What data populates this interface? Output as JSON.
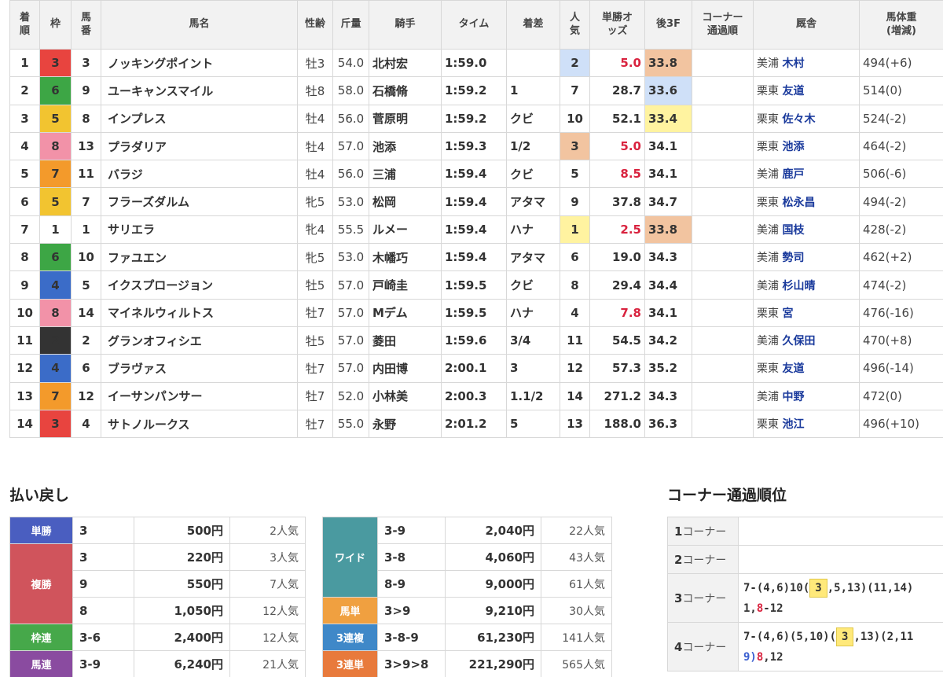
{
  "result_table": {
    "headers": {
      "rank": "着順",
      "waku": "枠",
      "umaban": "馬番",
      "name": "馬名",
      "sex_age": "性齢",
      "weight": "斤量",
      "jockey": "騎手",
      "time": "タイム",
      "margin": "着差",
      "pop": "人気",
      "odds": "単勝オッズ",
      "last3f": "後3F",
      "corner": "コーナー通過順",
      "stable": "厩舎",
      "body_weight": "馬体重(増減)"
    },
    "rows": [
      {
        "rank": "1",
        "waku": "3",
        "umaban": "3",
        "name": "ノッキングポイント",
        "sex_age": "牡3",
        "weight": "54.0",
        "jockey": "北村宏",
        "time": "1:59.0",
        "margin": "",
        "pop": "2",
        "odds": "5.0",
        "last3f": "33.8",
        "corner": "",
        "region": "美浦",
        "trainer": "木村",
        "body_weight": "494(+6)"
      },
      {
        "rank": "2",
        "waku": "6",
        "umaban": "9",
        "name": "ユーキャンスマイル",
        "sex_age": "牡8",
        "weight": "58.0",
        "jockey": "石橋脩",
        "time": "1:59.2",
        "margin": "1",
        "pop": "7",
        "odds": "28.7",
        "last3f": "33.6",
        "corner": "",
        "region": "栗東",
        "trainer": "友道",
        "body_weight": "514(0)"
      },
      {
        "rank": "3",
        "waku": "5",
        "umaban": "8",
        "name": "インプレス",
        "sex_age": "牡4",
        "weight": "56.0",
        "jockey": "菅原明",
        "time": "1:59.2",
        "margin": "クビ",
        "pop": "10",
        "odds": "52.1",
        "last3f": "33.4",
        "corner": "",
        "region": "栗東",
        "trainer": "佐々木",
        "body_weight": "524(-2)"
      },
      {
        "rank": "4",
        "waku": "8",
        "umaban": "13",
        "name": "プラダリア",
        "sex_age": "牡4",
        "weight": "57.0",
        "jockey": "池添",
        "time": "1:59.3",
        "margin": "1/2",
        "pop": "3",
        "odds": "5.0",
        "last3f": "34.1",
        "corner": "",
        "region": "栗東",
        "trainer": "池添",
        "body_weight": "464(-2)"
      },
      {
        "rank": "5",
        "waku": "7",
        "umaban": "11",
        "name": "バラジ",
        "sex_age": "牡4",
        "weight": "56.0",
        "jockey": "三浦",
        "time": "1:59.4",
        "margin": "クビ",
        "pop": "5",
        "odds": "8.5",
        "last3f": "34.1",
        "corner": "",
        "region": "美浦",
        "trainer": "鹿戸",
        "body_weight": "506(-6)"
      },
      {
        "rank": "6",
        "waku": "5",
        "umaban": "7",
        "name": "フラーズダルム",
        "sex_age": "牝5",
        "weight": "53.0",
        "jockey": "松岡",
        "time": "1:59.4",
        "margin": "アタマ",
        "pop": "9",
        "odds": "37.8",
        "last3f": "34.7",
        "corner": "",
        "region": "栗東",
        "trainer": "松永昌",
        "body_weight": "494(-2)"
      },
      {
        "rank": "7",
        "waku": "1",
        "umaban": "1",
        "name": "サリエラ",
        "sex_age": "牝4",
        "weight": "55.5",
        "jockey": "ルメー",
        "time": "1:59.4",
        "margin": "ハナ",
        "pop": "1",
        "odds": "2.5",
        "last3f": "33.8",
        "corner": "",
        "region": "美浦",
        "trainer": "国枝",
        "body_weight": "428(-2)"
      },
      {
        "rank": "8",
        "waku": "6",
        "umaban": "10",
        "name": "ファユエン",
        "sex_age": "牝5",
        "weight": "53.0",
        "jockey": "木幡巧",
        "time": "1:59.4",
        "margin": "アタマ",
        "pop": "6",
        "odds": "19.0",
        "last3f": "34.3",
        "corner": "",
        "region": "美浦",
        "trainer": "勢司",
        "body_weight": "462(+2)"
      },
      {
        "rank": "9",
        "waku": "4",
        "umaban": "5",
        "name": "イクスプロージョン",
        "sex_age": "牡5",
        "weight": "57.0",
        "jockey": "戸崎圭",
        "time": "1:59.5",
        "margin": "クビ",
        "pop": "8",
        "odds": "29.4",
        "last3f": "34.4",
        "corner": "",
        "region": "美浦",
        "trainer": "杉山晴",
        "body_weight": "474(-2)"
      },
      {
        "rank": "10",
        "waku": "8",
        "umaban": "14",
        "name": "マイネルウィルトス",
        "sex_age": "牡7",
        "weight": "57.0",
        "jockey": "Mデム",
        "time": "1:59.5",
        "margin": "ハナ",
        "pop": "4",
        "odds": "7.8",
        "last3f": "34.1",
        "corner": "",
        "region": "栗東",
        "trainer": "宮",
        "body_weight": "476(-16)"
      },
      {
        "rank": "11",
        "waku": "2",
        "umaban": "2",
        "name": "グランオフィシエ",
        "sex_age": "牡5",
        "weight": "57.0",
        "jockey": "菱田",
        "time": "1:59.6",
        "margin": "3/4",
        "pop": "11",
        "odds": "54.5",
        "last3f": "34.2",
        "corner": "",
        "region": "美浦",
        "trainer": "久保田",
        "body_weight": "470(+8)"
      },
      {
        "rank": "12",
        "waku": "4",
        "umaban": "6",
        "name": "ブラヴァス",
        "sex_age": "牡7",
        "weight": "57.0",
        "jockey": "内田博",
        "time": "2:00.1",
        "margin": "3",
        "pop": "12",
        "odds": "57.3",
        "last3f": "35.2",
        "corner": "",
        "region": "栗東",
        "trainer": "友道",
        "body_weight": "496(-14)"
      },
      {
        "rank": "13",
        "waku": "7",
        "umaban": "12",
        "name": "イーサンパンサー",
        "sex_age": "牡7",
        "weight": "52.0",
        "jockey": "小林美",
        "time": "2:00.3",
        "margin": "1.1/2",
        "pop": "14",
        "odds": "271.2",
        "last3f": "34.3",
        "corner": "",
        "region": "美浦",
        "trainer": "中野",
        "body_weight": "472(0)"
      },
      {
        "rank": "14",
        "waku": "3",
        "umaban": "4",
        "name": "サトノルークス",
        "sex_age": "牡7",
        "weight": "55.0",
        "jockey": "永野",
        "time": "2:01.2",
        "margin": "5",
        "pop": "13",
        "odds": "188.0",
        "last3f": "36.3",
        "corner": "",
        "region": "栗東",
        "trainer": "池江",
        "body_weight": "496(+10)"
      }
    ]
  },
  "colors": {
    "waku": {
      "1": "#ffffff",
      "2": "#333333",
      "3": "#e8443f",
      "4": "#3b6cc8",
      "5": "#f2c430",
      "6": "#3da645",
      "7": "#f39a2b",
      "8": "#f292a8"
    },
    "pop1": "#fff3a0",
    "pop2": "#cfe0f8",
    "pop3": "#f2c4a0",
    "f3_1": "#fff3a0",
    "f3_2": "#cfe0f8",
    "f3_3": "#f2c4a0",
    "odds_red": "#d9233f",
    "label_tansho": "#4a5ec0",
    "label_fukusho": "#d0545c",
    "label_wakuren": "#46a84a",
    "label_umaren": "#8a4ba0",
    "label_wide": "#4a9aa0",
    "label_umatan": "#f0a040",
    "label_sanrenpuku": "#3f88c8",
    "label_sanrentan": "#e87a3c"
  },
  "payout": {
    "title": "払い戻し",
    "left": {
      "tansho": {
        "label": "単勝",
        "rows": [
          {
            "combo": "3",
            "amount": "500円",
            "pop": "2人気"
          }
        ]
      },
      "fukusho": {
        "label": "複勝",
        "rows": [
          {
            "combo": "3",
            "amount": "220円",
            "pop": "3人気"
          },
          {
            "combo": "9",
            "amount": "550円",
            "pop": "7人気"
          },
          {
            "combo": "8",
            "amount": "1,050円",
            "pop": "12人気"
          }
        ]
      },
      "wakuren": {
        "label": "枠連",
        "rows": [
          {
            "combo": "3-6",
            "amount": "2,400円",
            "pop": "12人気"
          }
        ]
      },
      "umaren": {
        "label": "馬連",
        "rows": [
          {
            "combo": "3-9",
            "amount": "6,240円",
            "pop": "21人気"
          }
        ]
      }
    },
    "right": {
      "wide": {
        "label": "ワイド",
        "rows": [
          {
            "combo": "3-9",
            "amount": "2,040円",
            "pop": "22人気"
          },
          {
            "combo": "3-8",
            "amount": "4,060円",
            "pop": "43人気"
          },
          {
            "combo": "8-9",
            "amount": "9,000円",
            "pop": "61人気"
          }
        ]
      },
      "umatan": {
        "label": "馬単",
        "rows": [
          {
            "combo": "3>9",
            "amount": "9,210円",
            "pop": "30人気"
          }
        ]
      },
      "sanrenpuku": {
        "label": "3連複",
        "rows": [
          {
            "combo": "3-8-9",
            "amount": "61,230円",
            "pop": "141人気"
          }
        ]
      },
      "sanrentan": {
        "label": "3連単",
        "rows": [
          {
            "combo": "3>9>8",
            "amount": "221,290円",
            "pop": "565人気"
          }
        ]
      }
    }
  },
  "corner": {
    "title": "コーナー通過順位",
    "rows": [
      {
        "num": "1",
        "label": "コーナー",
        "lines": []
      },
      {
        "num": "2",
        "label": "コーナー",
        "lines": []
      },
      {
        "num": "3",
        "label": "コーナー",
        "line1_pre": "7-(4,6)10(",
        "line1_hl": "3",
        "line1_post": ",5,13)(11,14)",
        "line2_a": "1,",
        "line2_red": "8",
        "line2_b": "-12"
      },
      {
        "num": "4",
        "label": "コーナー",
        "line1_pre": "7-(4,6)(5,10)(",
        "line1_hl": "3",
        "line1_post": ",13)(2,11",
        "line2_blue": "9)",
        "line2_red": "8",
        "line2_b": ",12"
      }
    ]
  }
}
